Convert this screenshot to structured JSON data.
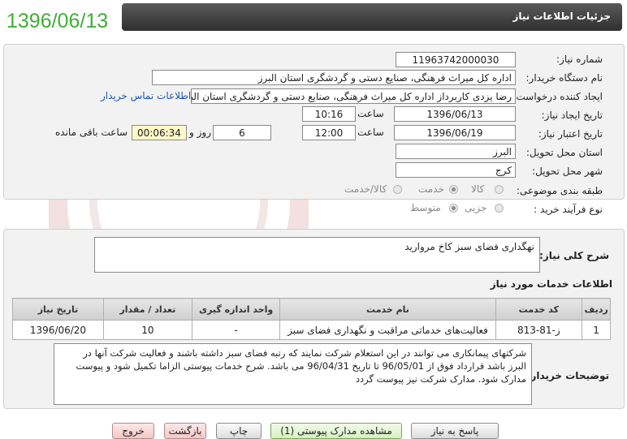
{
  "stamp_date": "1396/06/13",
  "header": {
    "title": "جزئیات اطلاعات نیاز"
  },
  "form": {
    "need_number": {
      "label": "شماره نیاز:",
      "value": "11963742000030"
    },
    "buyer_org": {
      "label": "نام دستگاه خریدار:",
      "value": "اداره کل میراث فرهنگی، صنایع دستی و گردشگری استان البرز"
    },
    "creator": {
      "label": "ایجاد کننده درخواست:",
      "value": "رضا یزدی کاربرداز اداره کل میراث فرهنگی، صنایع دستی و گردشگری استان البرز",
      "contact_link": "اطلاعات تماس خریدار"
    },
    "created": {
      "label": "تاریخ ایجاد نیاز:",
      "date": "1396/06/13",
      "time_label": "ساعت",
      "time": "10:16"
    },
    "validity": {
      "label": "تاریخ اعتبار نیاز:",
      "date": "1396/06/19",
      "time_label": "ساعت",
      "time": "12:00",
      "days": "6",
      "days_label": "روز و",
      "remaining": "00:06:34",
      "remaining_label": "ساعت باقی مانده"
    },
    "province": {
      "label": "استان محل تحویل:",
      "value": "البرز"
    },
    "city": {
      "label": "شهر محل تحویل:",
      "value": "کرج"
    },
    "category": {
      "label": "طبقه بندی موضوعی:",
      "options": [
        "کالا",
        "خدمت",
        "کالا/خدمت"
      ],
      "selected": "خدمت"
    },
    "process": {
      "label": "نوع فرآیند خرید :",
      "options": [
        "جزیی",
        "متوسط"
      ],
      "selected": "متوسط"
    }
  },
  "summary": {
    "label": "شرح کلی نیاز:",
    "value": "نهگداری فضای سبز کاخ مروارید"
  },
  "services": {
    "title": "اطلاعات خدمات مورد نیاز",
    "columns": [
      "ردیف",
      "کد خدمت",
      "نام خدمت",
      "واحد اندازه گیری",
      "تعداد / مقدار",
      "تاریخ نیاز"
    ],
    "rows": [
      [
        "1",
        "ز-81-813",
        "فعالیت‌های خدماتی مراقبت و نگهداری فضای سبز",
        "-",
        "10",
        "1396/06/20"
      ]
    ]
  },
  "buyer_notes": {
    "label": "توضیحات خریدار:",
    "lines": [
      "شرکتهای پیمانکاری می توانند در این استعلام شرکت نمایند که رتبه فضای سبز داشته باشند و فعالیت شرکت آنها در",
      "البرز باشد قرارداد فوق از 96/05/01 تا تاریخ 96/04/31 می باشد. شرح خدمات پیوستی الزاما تکمیل شود و پیوست",
      "مدارک شود. مدارک شرکت نیز پیوست گردد"
    ]
  },
  "buttons": {
    "reply": "پاسخ به نیاز",
    "view_attachments": "مشاهده مدارک پیوستی (1)",
    "print": "چاپ",
    "back": "بازگشت",
    "exit": "خروج"
  }
}
